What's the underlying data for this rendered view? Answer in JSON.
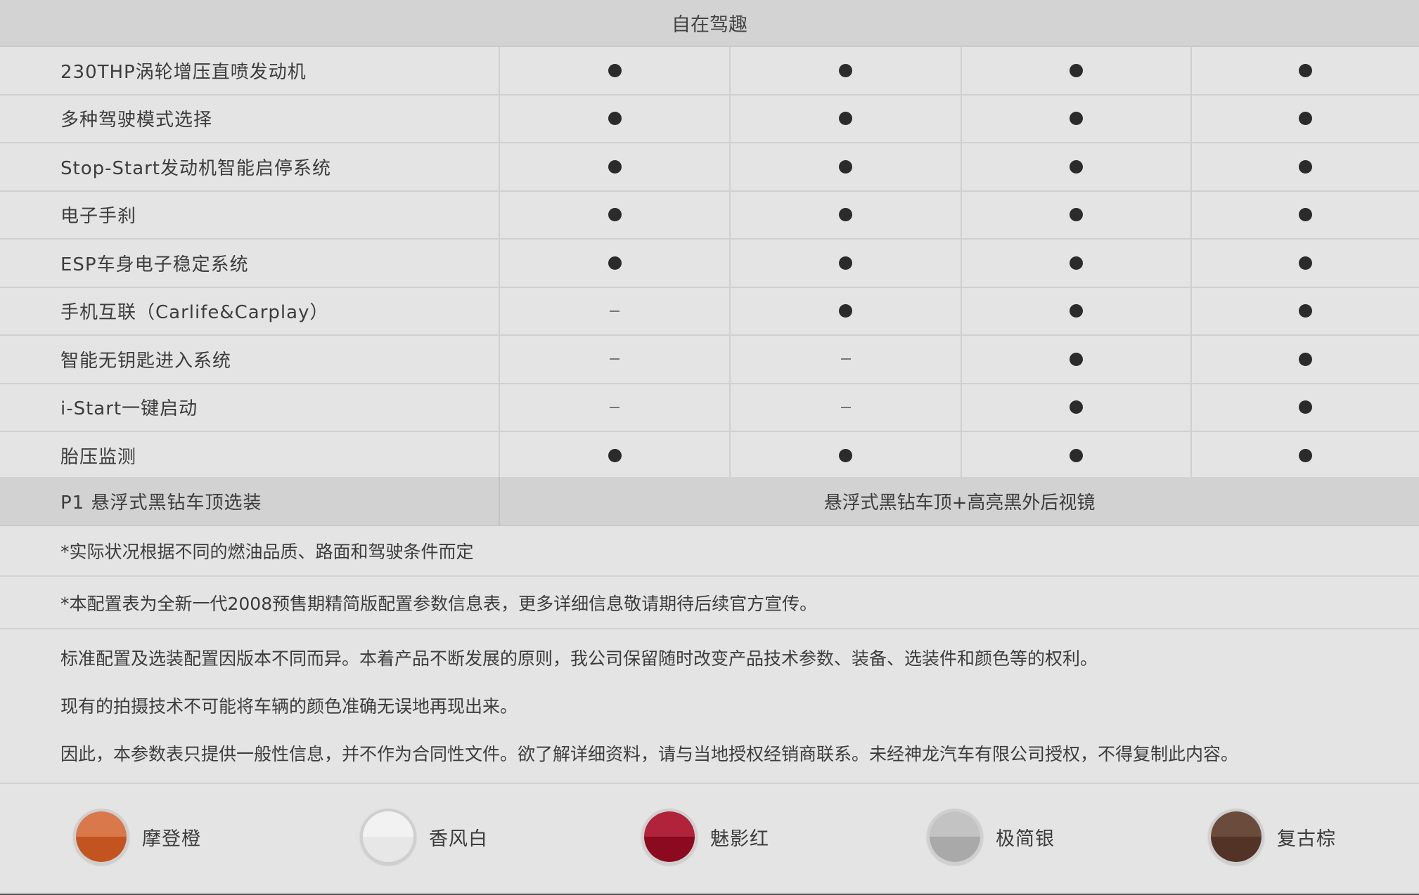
{
  "header": {
    "title": "自在驾趣"
  },
  "rows": [
    {
      "label": "230THP涡轮增压直喷发动机",
      "values": [
        "dot",
        "dot",
        "dot",
        "dot"
      ]
    },
    {
      "label": "多种驾驶模式选择",
      "values": [
        "dot",
        "dot",
        "dot",
        "dot"
      ]
    },
    {
      "label": "Stop-Start发动机智能启停系统",
      "values": [
        "dot",
        "dot",
        "dot",
        "dot"
      ]
    },
    {
      "label": "电子手刹",
      "values": [
        "dot",
        "dot",
        "dot",
        "dot"
      ]
    },
    {
      "label": "ESP车身电子稳定系统",
      "values": [
        "dot",
        "dot",
        "dot",
        "dot"
      ]
    },
    {
      "label": "手机互联（Carlife&Carplay）",
      "values": [
        "dash",
        "dot",
        "dot",
        "dot"
      ]
    },
    {
      "label": "智能无钥匙进入系统",
      "values": [
        "dash",
        "dash",
        "dot",
        "dot"
      ]
    },
    {
      "label": "i-Start一键启动",
      "values": [
        "dash",
        "dash",
        "dot",
        "dot"
      ]
    },
    {
      "label": "胎压监测",
      "values": [
        "dot",
        "dot",
        "dot",
        "dot"
      ]
    }
  ],
  "option": {
    "label": "P1 悬浮式黑钻车顶选装",
    "value": "悬浮式黑钻车顶+高亮黑外后视镜"
  },
  "notes": {
    "note1": "*实际状况根据不同的燃油品质、路面和驾驶条件而定",
    "note2": "*本配置表为全新一代2008预售期精简版配置参数信息表，更多详细信息敬请期待后续官方宣传。"
  },
  "disclaimer": {
    "line1": "标准配置及选装配置因版本不同而异。本着产品不断发展的原则，我公司保留随时改变产品技术参数、装备、选装件和颜色等的权利。",
    "line2": "现有的拍摄技术不可能将车辆的颜色准确无误地再现出来。",
    "line3": "因此，本参数表只提供一般性信息，并不作为合同性文件。欲了解详细资料，请与当地授权经销商联系。未经神龙汽车有限公司授权，不得复制此内容。"
  },
  "colors": [
    {
      "name": "摩登橙",
      "top": "#d9784a",
      "bottom": "#c35420"
    },
    {
      "name": "香风白",
      "top": "#f2f2f2",
      "bottom": "#e7e7e7"
    },
    {
      "name": "魅影红",
      "top": "#b0233a",
      "bottom": "#8c0a1f"
    },
    {
      "name": "极简银",
      "top": "#c3c3c3",
      "bottom": "#a9a9a9"
    },
    {
      "name": "复古棕",
      "top": "#6b4c3c",
      "bottom": "#533325"
    }
  ]
}
